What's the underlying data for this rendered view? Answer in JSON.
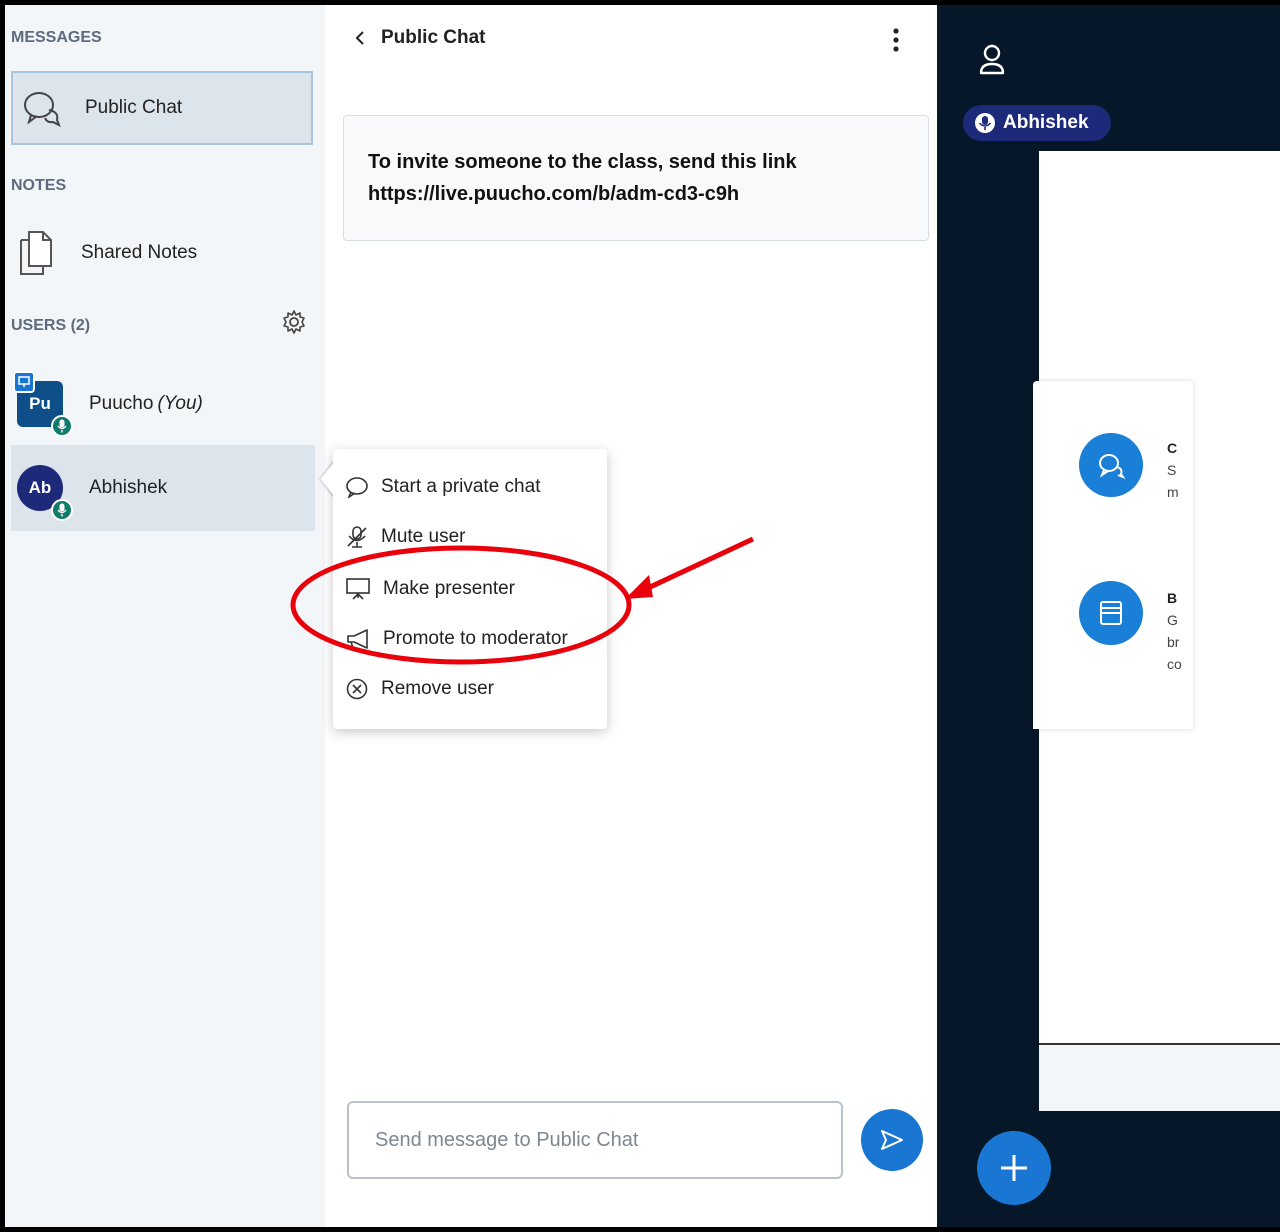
{
  "sidebar": {
    "messages_title": "MESSAGES",
    "public_chat_label": "Public Chat",
    "notes_title": "NOTES",
    "shared_notes_label": "Shared Notes",
    "users_title": "USERS (2)",
    "users": [
      {
        "initials": "Pu",
        "name": "Puucho",
        "suffix": "(You)"
      },
      {
        "initials": "Ab",
        "name": "Abhishek",
        "suffix": ""
      }
    ]
  },
  "chat": {
    "title": "Public Chat",
    "welcome_line1": "To invite someone to the class, send this link",
    "welcome_line2": "https://live.puucho.com/b/adm-cd3-c9h",
    "input_placeholder": "Send message to Public Chat"
  },
  "context_menu": {
    "items": [
      {
        "label": "Start a private chat",
        "icon": "chat-bubble-icon"
      },
      {
        "label": "Mute user",
        "icon": "mic-off-icon"
      },
      {
        "label": "Make presenter",
        "icon": "presentation-icon"
      },
      {
        "label": "Promote to moderator",
        "icon": "megaphone-icon"
      },
      {
        "label": "Remove user",
        "icon": "remove-circle-icon"
      }
    ]
  },
  "presentation": {
    "talking_user": "Abhishek",
    "options": [
      {
        "title": "C",
        "desc": "S\nm",
        "icon": "chat-icon"
      },
      {
        "title": "B",
        "desc": "G\nbr\nco",
        "icon": "breakout-icon"
      }
    ]
  },
  "colors": {
    "accent": "#1976d2",
    "sidebar_bg": "#f3f6f9",
    "dark_bg": "#06172a",
    "annotation": "#e8000b"
  }
}
